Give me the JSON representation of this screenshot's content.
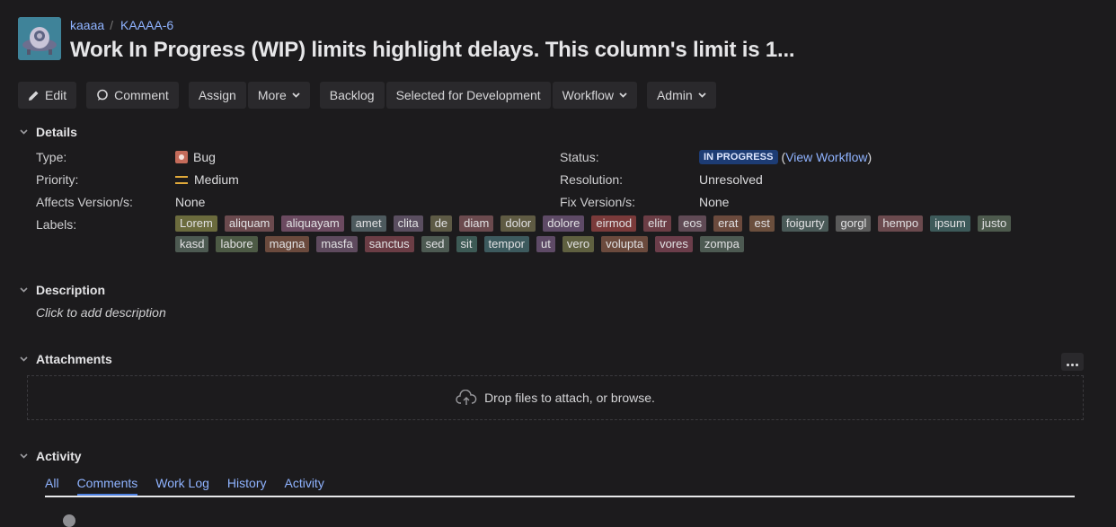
{
  "header": {
    "project": "kaaaa",
    "issue_key": "KAAAA-6",
    "title": "Work In Progress (WIP) limits highlight delays. This column's limit is 1..."
  },
  "toolbar": {
    "edit": "Edit",
    "comment": "Comment",
    "assign": "Assign",
    "more": "More",
    "backlog": "Backlog",
    "selected": "Selected for Development",
    "workflow": "Workflow",
    "admin": "Admin"
  },
  "details": {
    "heading": "Details",
    "type_label": "Type:",
    "type_value": "Bug",
    "priority_label": "Priority:",
    "priority_value": "Medium",
    "affects_label": "Affects Version/s:",
    "affects_value": "None",
    "labels_label": "Labels:",
    "status_label": "Status:",
    "status_value": "IN PROGRESS",
    "view_workflow": "View Workflow",
    "paren_open": "(",
    "paren_close": ")",
    "resolution_label": "Resolution:",
    "resolution_value": "Unresolved",
    "fix_label": "Fix Version/s:",
    "fix_value": "None",
    "labels": [
      {
        "text": "Lorem",
        "color": "#6b6b3d"
      },
      {
        "text": "aliquam",
        "color": "#6b4a4e"
      },
      {
        "text": "aliquayam",
        "color": "#6b4a60"
      },
      {
        "text": "amet",
        "color": "#4d5a5e"
      },
      {
        "text": "clita",
        "color": "#5a4e60"
      },
      {
        "text": "de",
        "color": "#5d5a45"
      },
      {
        "text": "diam",
        "color": "#6b4a4e"
      },
      {
        "text": "dolor",
        "color": "#5f5b43"
      },
      {
        "text": "dolore",
        "color": "#5e4a66"
      },
      {
        "text": "eirmod",
        "color": "#7a3a3a"
      },
      {
        "text": "elitr",
        "color": "#6b3d45"
      },
      {
        "text": "eos",
        "color": "#604a55"
      },
      {
        "text": "erat",
        "color": "#6b4a3d"
      },
      {
        "text": "est",
        "color": "#6b4f3d"
      },
      {
        "text": "foigurty",
        "color": "#4a5a58"
      },
      {
        "text": "gorgl",
        "color": "#5a5a5a"
      },
      {
        "text": "hempo",
        "color": "#6b4a4e"
      },
      {
        "text": "ipsum",
        "color": "#3d5a5a"
      },
      {
        "text": "justo",
        "color": "#4d5a4d"
      },
      {
        "text": "kasd",
        "color": "#4d5a52"
      },
      {
        "text": "labore",
        "color": "#4d5a45"
      },
      {
        "text": "magna",
        "color": "#6b4a3d"
      },
      {
        "text": "masfa",
        "color": "#5e4a5e"
      },
      {
        "text": "sanctus",
        "color": "#6b3d45"
      },
      {
        "text": "sed",
        "color": "#4d5a52"
      },
      {
        "text": "sit",
        "color": "#3d5a55"
      },
      {
        "text": "tempor",
        "color": "#3d5a5e"
      },
      {
        "text": "ut",
        "color": "#5e4a66"
      },
      {
        "text": "vero",
        "color": "#5f6040"
      },
      {
        "text": "volupta",
        "color": "#6b4a3d"
      },
      {
        "text": "vores",
        "color": "#6b3d4a"
      },
      {
        "text": "zompa",
        "color": "#4d5a52"
      }
    ]
  },
  "description": {
    "heading": "Description",
    "placeholder": "Click to add description"
  },
  "attachments": {
    "heading": "Attachments",
    "drop_text": "Drop files to attach, or browse."
  },
  "activity": {
    "heading": "Activity",
    "tabs": [
      "All",
      "Comments",
      "Work Log",
      "History",
      "Activity"
    ],
    "active_tab": "Comments"
  }
}
